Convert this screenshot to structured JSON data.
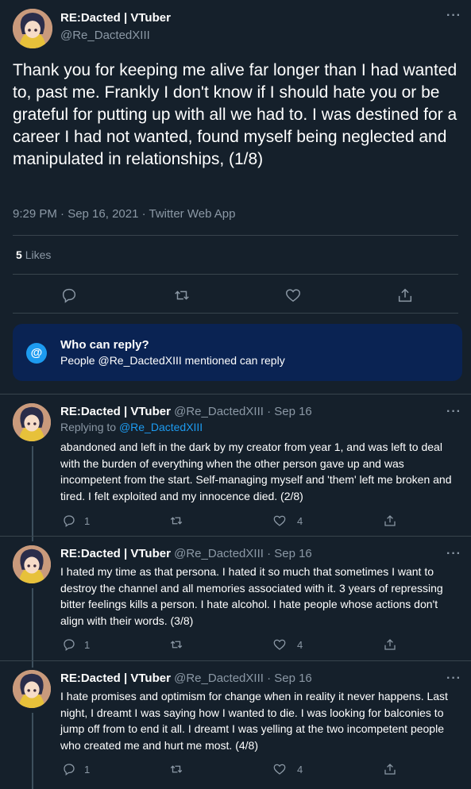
{
  "main": {
    "display_name": "RE:Dacted | VTuber",
    "handle": "@Re_DactedXIII",
    "text": "Thank you for keeping me alive far longer than I had wanted to, past me. Frankly I don't know if I should hate you or be grateful for putting up with all we had to. I was destined for a career I had not wanted, found myself being neglected and manipulated in relationships, (1/8)",
    "meta": "9:29 PM · Sep 16, 2021 · Twitter Web App",
    "likes_count": "5",
    "likes_label": "Likes",
    "more": "···"
  },
  "reply_box": {
    "icon": "@",
    "title": "Who can reply?",
    "description": "People @Re_DactedXIII mentioned can reply"
  },
  "replies": [
    {
      "display_name": "RE:Dacted | VTuber",
      "meta": "@Re_DactedXIII · Sep 16",
      "replying_prefix": "Replying to",
      "replying_handle": "@Re_DactedXIII",
      "text": "abandoned and left in the dark by my creator from year 1, and was left to deal with the burden of everything when the other person gave up and was incompetent from the start. Self-managing myself and 'them' left me broken and tired. I felt exploited and my innocence died. (2/8)",
      "reply_count": "1",
      "like_count": "4",
      "more": "···"
    },
    {
      "display_name": "RE:Dacted | VTuber",
      "meta": "@Re_DactedXIII · Sep 16",
      "text": "I hated my time as that persona. I hated it so much that sometimes I want to destroy the channel and all memories associated with it. 3 years of repressing bitter feelings kills a person. I hate alcohol. I hate people whose actions don't align with their words. (3/8)",
      "reply_count": "1",
      "like_count": "4",
      "more": "···"
    },
    {
      "display_name": "RE:Dacted | VTuber",
      "meta": "@Re_DactedXIII · Sep 16",
      "text": "I hate promises and optimism for change when in reality it never happens. Last night, I dreamt I was saying how I wanted to die. I was looking for balconies to jump off from to end it all. I dreamt I was yelling at the two incompetent people who created me and hurt me most. (4/8)",
      "reply_count": "1",
      "like_count": "4",
      "more": "···"
    }
  ],
  "icons": {
    "reply": "reply-icon",
    "retweet": "retweet-icon",
    "like": "like-icon",
    "share": "share-icon"
  },
  "colors": {
    "background": "#15202b",
    "accent": "#1d9bf0",
    "muted": "#8b98a5",
    "reply_box": "#0a2353"
  }
}
